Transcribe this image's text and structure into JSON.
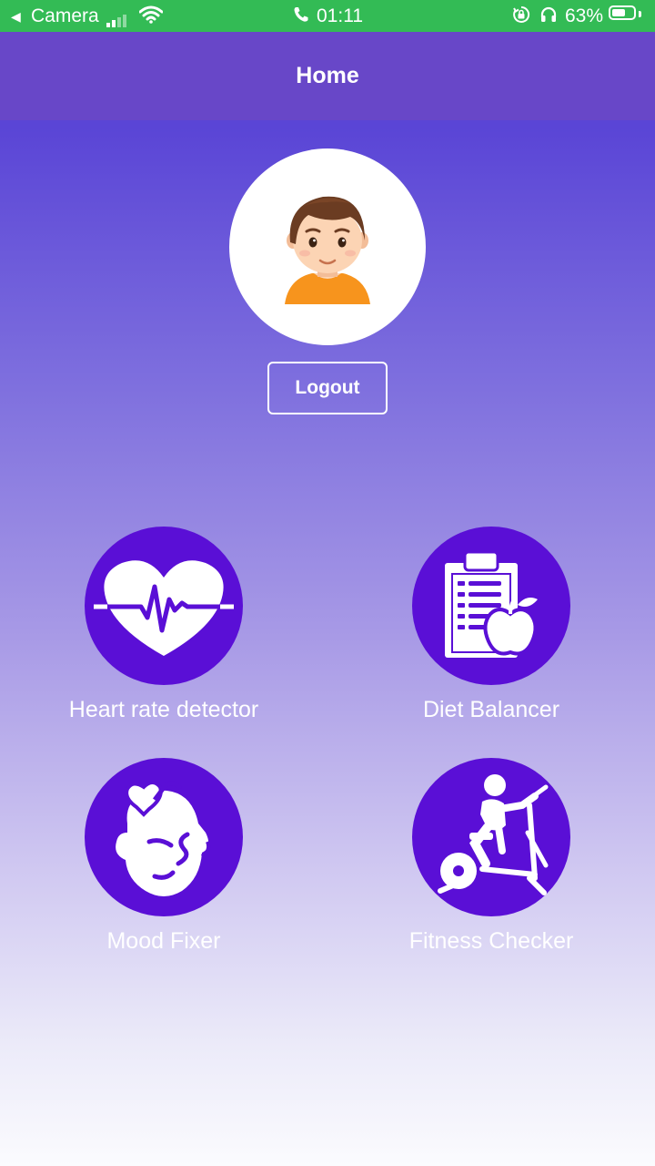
{
  "status_bar": {
    "back_app": "Camera",
    "time": "01:11",
    "battery_percent": "63%",
    "battery_level": 0.63,
    "background_color": "#33bb55"
  },
  "app_bar": {
    "title": "Home",
    "background_color": "#6847c8"
  },
  "profile": {
    "avatar_icon": "boy-avatar-icon",
    "logout_label": "Logout"
  },
  "features": [
    {
      "label": "Heart rate detector",
      "icon": "heart-rate-icon"
    },
    {
      "label": "Diet Balancer",
      "icon": "clipboard-apple-icon"
    },
    {
      "label": "Mood Fixer",
      "icon": "mood-face-icon"
    },
    {
      "label": "Fitness Checker",
      "icon": "exercise-bike-icon"
    }
  ],
  "colors": {
    "feature_circle": "#5a0fd6",
    "gradient_top": "#5a45d6",
    "gradient_bottom": "#fbfbfe"
  }
}
